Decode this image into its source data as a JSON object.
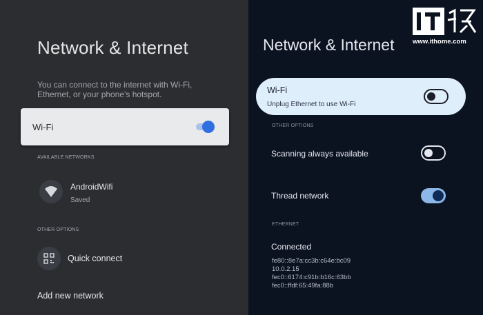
{
  "left": {
    "title": "Network & Internet",
    "description": "You can connect to the internet with Wi-Fi, Ethernet, or your phone's hotspot.",
    "wifi": {
      "label": "Wi-Fi",
      "enabled": true
    },
    "available_networks_header": "AVAILABLE NETWORKS",
    "networks": [
      {
        "name": "AndroidWifi",
        "status": "Saved",
        "icon": "wifi-icon"
      }
    ],
    "other_options_header": "OTHER OPTIONS",
    "quick_connect": {
      "label": "Quick connect",
      "icon": "qr-code-icon"
    },
    "add_network_label": "Add new network"
  },
  "right": {
    "title": "Network & Internet",
    "wifi": {
      "label": "Wi-Fi",
      "subtitle": "Unplug Ethernet to use Wi-Fi",
      "enabled": false
    },
    "other_options_header": "OTHER OPTIONS",
    "scanning": {
      "label": "Scanning always available",
      "enabled": false
    },
    "thread": {
      "label": "Thread network",
      "enabled": true
    },
    "ethernet_header": "ETHERNET",
    "ethernet": {
      "status": "Connected",
      "addresses": [
        "fe80::8e7a:cc3b:c64e:bc09",
        "10.0.2.15",
        "fec0::6174:c91b:b16c:63bb",
        "fec0::ffdf:65:49fa:88b"
      ]
    }
  },
  "watermark": {
    "brand": "IT之家",
    "url": "www.ithome.com"
  },
  "colors": {
    "left_bg": "#2b2d31",
    "right_bg": "#0b1220",
    "accent_blue": "#2f6fe0",
    "toggle_on_track": "#8bb8e8",
    "wifi_card_right": "#dfeefb"
  }
}
